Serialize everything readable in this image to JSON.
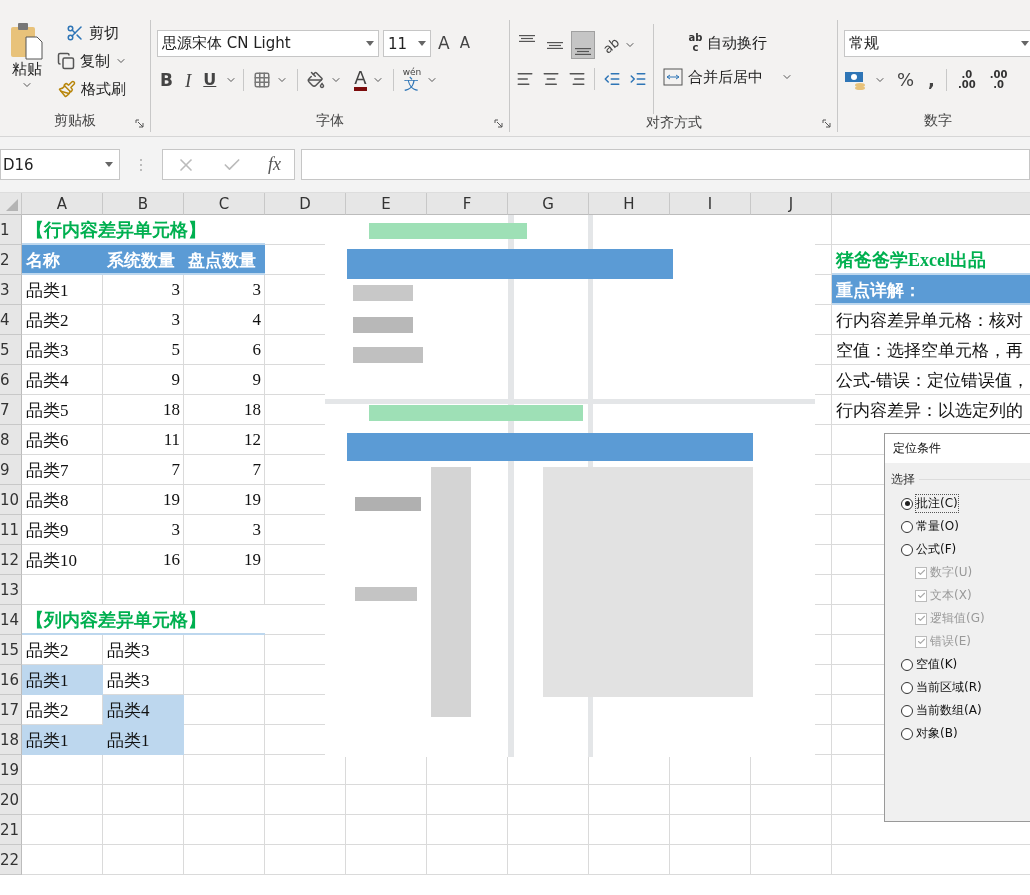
{
  "ribbon": {
    "clipboard": {
      "paste": "粘贴",
      "cut": "剪切",
      "copy": "复制",
      "format_painter": "格式刷",
      "label": "剪贴板"
    },
    "font": {
      "name": "思源宋体 CN Light",
      "size": "11",
      "grow": "A",
      "shrink": "A",
      "bold": "B",
      "italic": "I",
      "underline": "U",
      "font_color": "A",
      "phonetic_ruby": "wén",
      "phonetic": "文",
      "label": "字体"
    },
    "alignment": {
      "vertical": [
        {
          "selected": false
        },
        {
          "selected": false
        },
        {
          "selected": true
        }
      ],
      "orientation_glyph": "ab",
      "wrap_glyph": "ab",
      "wrap_glyph_2": "c",
      "wrap_text": "自动换行",
      "merge": "合并后居中",
      "label": "对齐方式"
    },
    "number": {
      "format": "常规",
      "percent": "%",
      "comma": ",",
      "increase_decimal": [
        ".0",
        ".00"
      ],
      "decrease_decimal": [
        ".00",
        ".0"
      ],
      "label": "数字"
    }
  },
  "formula_bar": {
    "name_box": "D16",
    "fx": "fx"
  },
  "sheet": {
    "columns": [
      "A",
      "B",
      "C",
      "D",
      "E",
      "F",
      "G",
      "H",
      "I",
      "J"
    ],
    "rows": [
      {
        "label": "1",
        "a": {
          "kind": "title",
          "text": "【行内容差异单元格】"
        }
      },
      {
        "label": "2",
        "a": {
          "kind": "header",
          "text": "名称"
        },
        "b": {
          "kind": "header",
          "text": "系统数量"
        },
        "c": {
          "kind": "header",
          "text": "盘点数量"
        },
        "k": {
          "kind": "title",
          "text": "猪爸爸学Excel出品"
        }
      },
      {
        "label": "3",
        "a": {
          "kind": "text",
          "text": "品类1"
        },
        "b": {
          "kind": "number",
          "text": "3"
        },
        "c": {
          "kind": "number",
          "text": "3"
        },
        "k": {
          "kind": "header",
          "text": "重点详解："
        }
      },
      {
        "label": "4",
        "a": {
          "kind": "text",
          "text": "品类2"
        },
        "b": {
          "kind": "number",
          "text": "3"
        },
        "c": {
          "kind": "number",
          "text": "4"
        },
        "k": {
          "kind": "text",
          "text": "行内容差异单元格：核对"
        }
      },
      {
        "label": "5",
        "a": {
          "kind": "text",
          "text": "品类3"
        },
        "b": {
          "kind": "number",
          "text": "5"
        },
        "c": {
          "kind": "number",
          "text": "6"
        },
        "k": {
          "kind": "text",
          "text": "空值：选择空单元格，再"
        }
      },
      {
        "label": "6",
        "a": {
          "kind": "text",
          "text": "品类4"
        },
        "b": {
          "kind": "number",
          "text": "9"
        },
        "c": {
          "kind": "number",
          "text": "9"
        },
        "k": {
          "kind": "text",
          "text": "公式-错误：定位错误值，"
        }
      },
      {
        "label": "7",
        "a": {
          "kind": "text",
          "text": "品类5"
        },
        "b": {
          "kind": "number",
          "text": "18"
        },
        "c": {
          "kind": "number",
          "text": "18"
        },
        "k": {
          "kind": "text",
          "text": "行内容差异：以选定列的"
        }
      },
      {
        "label": "8",
        "a": {
          "kind": "text",
          "text": "品类6"
        },
        "b": {
          "kind": "number",
          "text": "11"
        },
        "c": {
          "kind": "number",
          "text": "12"
        }
      },
      {
        "label": "9",
        "a": {
          "kind": "text",
          "text": "品类7"
        },
        "b": {
          "kind": "number",
          "text": "7"
        },
        "c": {
          "kind": "number",
          "text": "7"
        }
      },
      {
        "label": "10",
        "a": {
          "kind": "text",
          "text": "品类8"
        },
        "b": {
          "kind": "number",
          "text": "19"
        },
        "c": {
          "kind": "number",
          "text": "19"
        }
      },
      {
        "label": "11",
        "a": {
          "kind": "text",
          "text": "品类9"
        },
        "b": {
          "kind": "number",
          "text": "3"
        },
        "c": {
          "kind": "number",
          "text": "3"
        }
      },
      {
        "label": "12",
        "a": {
          "kind": "text",
          "text": "品类10"
        },
        "b": {
          "kind": "number",
          "text": "16"
        },
        "c": {
          "kind": "number",
          "text": "19"
        }
      },
      {
        "label": "13"
      },
      {
        "label": "14",
        "a": {
          "kind": "title",
          "text": "【列内容差异单元格】"
        }
      },
      {
        "label": "15",
        "a": {
          "kind": "text",
          "text": "品类2",
          "highlighted": false
        },
        "b": {
          "kind": "text",
          "text": "品类3",
          "highlighted": false
        }
      },
      {
        "label": "16",
        "a": {
          "kind": "text",
          "text": "品类1",
          "highlighted": true
        },
        "b": {
          "kind": "text",
          "text": "品类3",
          "highlighted": false
        }
      },
      {
        "label": "17",
        "a": {
          "kind": "text",
          "text": "品类2",
          "highlighted": false
        },
        "b": {
          "kind": "text",
          "text": "品类4",
          "highlighted": true
        }
      },
      {
        "label": "18",
        "a": {
          "kind": "text",
          "text": "品类1",
          "highlighted": true
        },
        "b": {
          "kind": "text",
          "text": "品类1",
          "highlighted": true
        }
      },
      {
        "label": "19"
      },
      {
        "label": "20"
      },
      {
        "label": "21"
      },
      {
        "label": "22"
      }
    ]
  },
  "dialog": {
    "title": "定位条件",
    "section": "选择",
    "options": [
      {
        "kind": "radio",
        "label": "批注(C)",
        "selected": true
      },
      {
        "kind": "radio",
        "label": "常量(O)",
        "selected": false
      },
      {
        "kind": "radio",
        "label": "公式(F)",
        "selected": false,
        "children": [
          {
            "kind": "checkbox",
            "label": "数字(U)",
            "checked": true,
            "disabled": true
          },
          {
            "kind": "checkbox",
            "label": "文本(X)",
            "checked": true,
            "disabled": true
          },
          {
            "kind": "checkbox",
            "label": "逻辑值(G)",
            "checked": true,
            "disabled": true
          },
          {
            "kind": "checkbox",
            "label": "错误(E)",
            "checked": true,
            "disabled": true
          }
        ]
      },
      {
        "kind": "radio",
        "label": "空值(K)",
        "selected": false
      },
      {
        "kind": "radio",
        "label": "当前区域(R)",
        "selected": false
      },
      {
        "kind": "radio",
        "label": "当前数组(A)",
        "selected": false
      },
      {
        "kind": "radio",
        "label": "对象(B)",
        "selected": false
      }
    ]
  }
}
